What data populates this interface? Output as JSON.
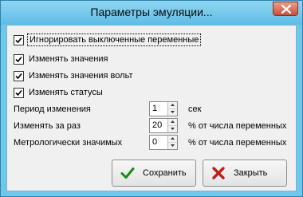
{
  "window": {
    "title": "Параметры эмуляции..."
  },
  "checkboxes": [
    {
      "label": "Игнорировать выключенные переменные",
      "checked": true
    },
    {
      "label": "Изменять значения",
      "checked": true
    },
    {
      "label": "Изменять значения вольт",
      "checked": true
    },
    {
      "label": "Изменять статусы",
      "checked": true
    }
  ],
  "fields": [
    {
      "label": "Период изменения",
      "value": "1",
      "unit": "сек"
    },
    {
      "label": "Изменять за раз",
      "value": "20",
      "unit": "% от числа переменных"
    },
    {
      "label": "Метрологически значимых",
      "value": "0",
      "unit": "% от числа переменных"
    }
  ],
  "buttons": {
    "save_label": "Сохранить",
    "close_label": "Закрыть"
  },
  "colors": {
    "frame": "#6ec8ea",
    "close_button": "#c9503a",
    "save_icon": "#1a8a1a",
    "close_icon": "#c41a1a"
  }
}
